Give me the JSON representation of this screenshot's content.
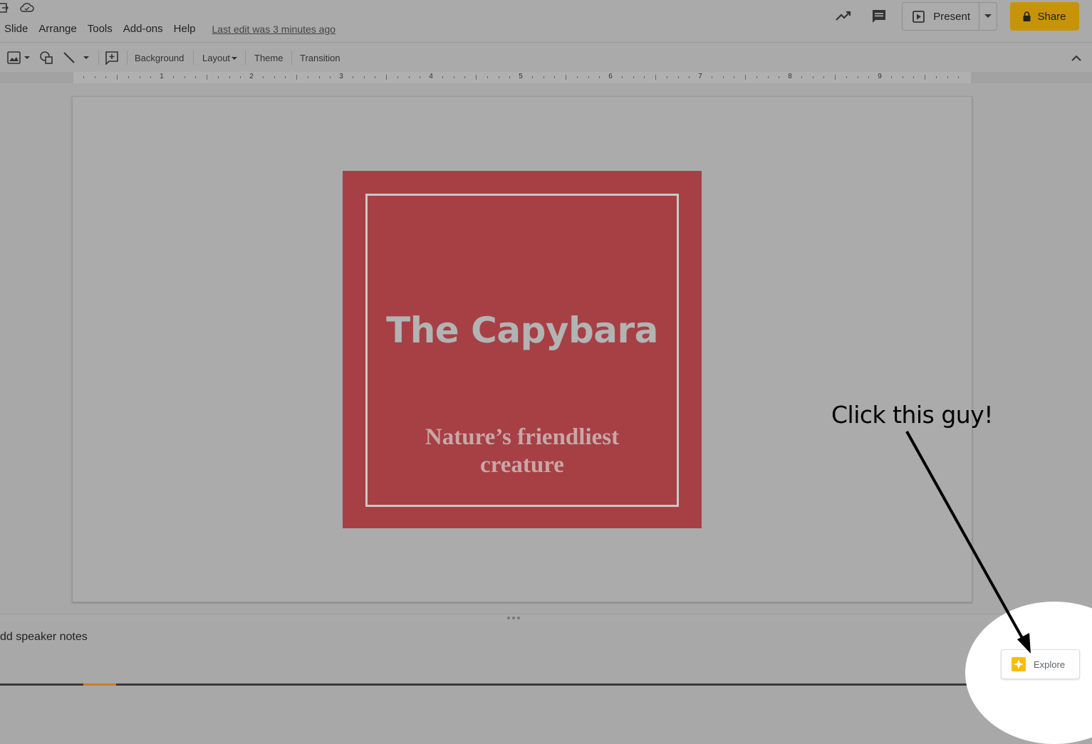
{
  "menubar": {
    "items": [
      "Slide",
      "Arrange",
      "Tools",
      "Add-ons",
      "Help"
    ],
    "last_edit": "Last edit was 3 minutes ago"
  },
  "header": {
    "present_label": "Present",
    "share_label": "Share"
  },
  "toolbar": {
    "background_label": "Background",
    "layout_label": "Layout",
    "theme_label": "Theme",
    "transition_label": "Transition"
  },
  "ruler": {
    "numbers": [
      "1",
      "2",
      "3",
      "4",
      "5",
      "6",
      "7",
      "8",
      "9"
    ]
  },
  "slide": {
    "title": "The Capybara",
    "subtitle_line1": "Nature’s friendliest",
    "subtitle_line2": "creature"
  },
  "notes": {
    "placeholder": "dd speaker notes"
  },
  "explore": {
    "label": "Explore"
  },
  "annotation": {
    "text": "Click this guy!"
  },
  "colors": {
    "slide_card": "#a64045",
    "share_button": "#c7930a",
    "explore_icon": "#fbbc04"
  }
}
